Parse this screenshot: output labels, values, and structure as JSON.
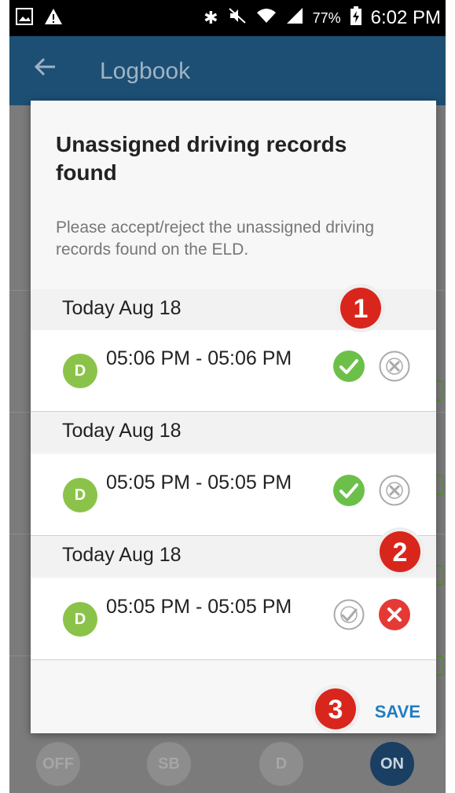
{
  "status_bar": {
    "battery": "77%",
    "time": "6:02 PM",
    "left_icons": [
      "image-icon",
      "warning-icon"
    ],
    "right_icons": [
      "bluetooth-icon",
      "mute-icon",
      "wifi-icon",
      "signal-icon",
      "battery-icon"
    ]
  },
  "app_bar": {
    "title": "Logbook"
  },
  "background": {
    "bottom_buttons": [
      "OFF",
      "SB",
      "D",
      "ON"
    ]
  },
  "dialog": {
    "title": "Unassigned driving records found",
    "message": "Please accept/reject the unassigned driving records found on the ELD.",
    "records": [
      {
        "date": "Today Aug 18",
        "badge": "D",
        "time_range": "05:06 PM - 05:06 PM",
        "status": "accepted"
      },
      {
        "date": "Today Aug 18",
        "badge": "D",
        "time_range": "05:05 PM - 05:05 PM",
        "status": "accepted"
      },
      {
        "date": "Today Aug 18",
        "badge": "D",
        "time_range": "05:05 PM - 05:05 PM",
        "status": "rejected"
      }
    ],
    "save_label": "SAVE"
  },
  "annotations": {
    "markers": [
      "1",
      "2",
      "3"
    ],
    "marker_color": "#d9261c"
  },
  "colors": {
    "accept_active": "#6cc04a",
    "reject_active": "#e53935",
    "badge": "#8bc34a",
    "save": "#1f7dc2",
    "app_bar": "#1d4f74"
  }
}
